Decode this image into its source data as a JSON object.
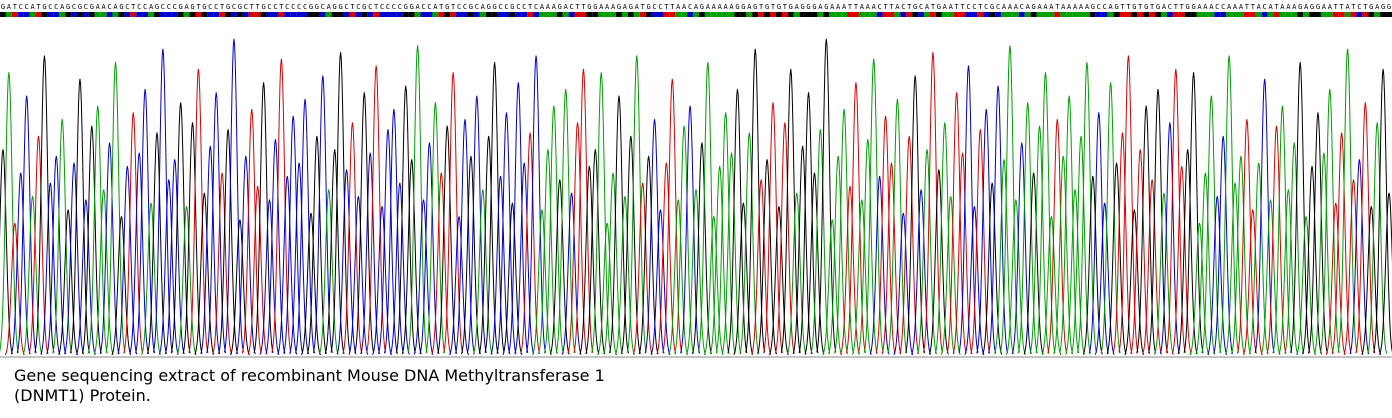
{
  "chart_data": {
    "type": "line",
    "title": "",
    "xlabel": "",
    "ylabel": "",
    "colors": {
      "A": "#00a000",
      "C": "#0000cc",
      "G": "#000000",
      "T": "#dd0000"
    },
    "sequence": "GATCCATGCCAGCGCGAACAGCTCCAGCCCGAGTGCCTGCGCTTGCCTCCCCGGCAGGCTCGCTCCCCGGACCATGTCCGCAGGCCGCCTCAAAGACTTGGAAAGAGATGCCTTAACAGAAAAAGGAGTGTGTGAGGGAGAAATTAAACTTACTGCATGAATTCCTCGCAAACAGAAATAAAAAGCCAGTTGTGTGACTTGGAAACCAAATTACATAAAGAGGAATTATCTGAGG",
    "peak_heights": [
      0.62,
      0.85,
      0.4,
      0.55,
      0.78,
      0.48,
      0.66,
      0.9,
      0.52,
      0.6,
      0.71,
      0.44,
      0.58,
      0.83,
      0.47,
      0.69,
      0.75,
      0.5,
      0.64,
      0.88,
      0.42,
      0.57,
      0.73,
      0.61,
      0.8,
      0.46,
      0.67,
      0.92,
      0.53,
      0.59,
      0.76,
      0.45,
      0.7,
      0.86,
      0.49,
      0.63,
      0.79,
      0.55,
      0.68,
      0.95,
      0.41,
      0.6,
      0.74,
      0.51,
      0.82,
      0.47,
      0.65,
      0.89,
      0.54,
      0.72,
      0.58,
      0.77,
      0.43,
      0.66,
      0.84,
      0.5,
      0.62,
      0.91,
      0.56,
      0.7,
      0.48,
      0.79,
      0.61,
      0.87,
      0.45,
      0.68,
      0.74,
      0.52,
      0.81,
      0.59,
      0.93,
      0.47,
      0.64,
      0.76,
      0.55,
      0.69,
      0.85,
      0.42,
      0.71,
      0.6,
      0.78,
      0.5,
      0.66,
      0.88,
      0.54,
      0.73,
      0.46,
      0.82,
      0.58,
      0.67,
      0.9,
      0.44,
      0.62,
      0.75,
      0.53,
      0.8,
      0.49,
      0.7,
      0.86,
      0.57
    ]
  },
  "caption": {
    "line1": "Gene sequencing extract of recombinant Mouse DNA Methyltransferase 1",
    "line2": "(DNMT1) Protein."
  }
}
